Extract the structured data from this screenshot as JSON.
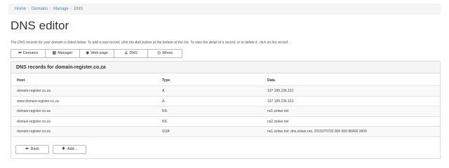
{
  "breadcrumb": {
    "items": [
      "Home",
      "Domains",
      "Manage"
    ],
    "current": "DNS",
    "separator": "/"
  },
  "title": "DNS editor",
  "intro": "The DNS records for your domain is listed below. To add a new record, click the Add button at the bottom of the list. To view the detail of a record, or to delete it, click on the record.",
  "tabs": [
    {
      "label": "Domains",
      "icon": "arrow-left-icon"
    },
    {
      "label": "Manager",
      "icon": "grid-icon"
    },
    {
      "label": "Web page",
      "icon": "globe-icon"
    },
    {
      "label": "DNS",
      "icon": "link-icon"
    },
    {
      "label": "Whois",
      "icon": "eye-icon"
    }
  ],
  "panel": {
    "heading": "DNS records for domain-register.co.za"
  },
  "table": {
    "columns": [
      "Host",
      "Type",
      "Data"
    ],
    "rows": [
      [
        "domain-register.co.za",
        "A",
        "197.189.236.161"
      ],
      [
        "www.domain-register.co.za",
        "A",
        "197.189.236.161"
      ],
      [
        "domain-register.co.za",
        "NS",
        "ns1.zelwe.net"
      ],
      [
        "domain-register.co.za",
        "NS",
        "ns2.zelwe.net"
      ],
      [
        "domain-register.co.za",
        "SOA",
        "ns1.zelwe.net. dns.zelwe.net. 2015070702 900 600 86400 3600"
      ]
    ]
  },
  "buttons": {
    "back": "Back",
    "add": "Add..."
  },
  "colors": {
    "link": "#428bca",
    "panel_heading_bg": "#f5f5f5",
    "stripe": "#f9f9f9"
  }
}
